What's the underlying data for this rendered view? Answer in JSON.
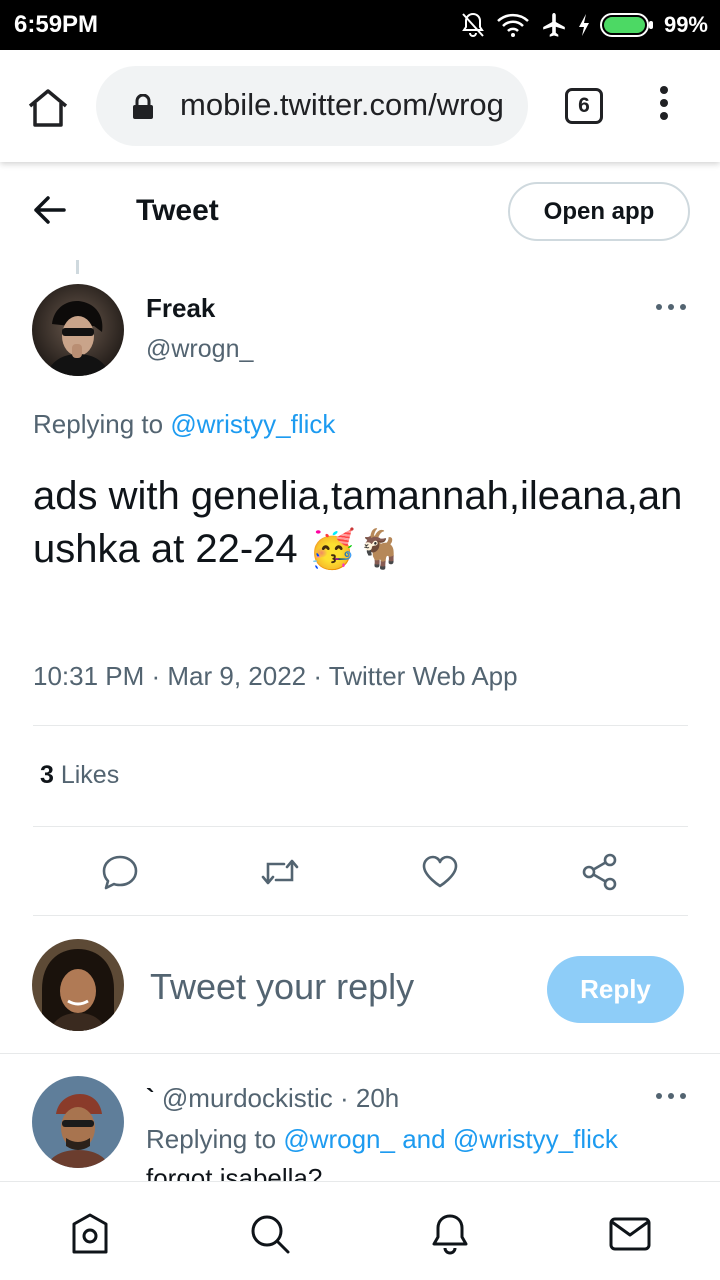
{
  "status_bar": {
    "time": "6:59PM",
    "battery_percent": "99%",
    "icons": [
      "bell-muted-icon",
      "wifi-icon",
      "airplane-icon",
      "charging-bolt-icon",
      "battery-icon"
    ]
  },
  "browser": {
    "url": "mobile.twitter.com/wrogn_",
    "tab_count": "6",
    "icons": [
      "home-icon",
      "lock-icon",
      "overflow-menu-icon"
    ]
  },
  "header": {
    "title": "Tweet",
    "open_app_label": "Open app"
  },
  "tweet": {
    "author_name": "Freak",
    "author_handle": "@wrogn_",
    "replying_prefix": "Replying to ",
    "replying_to": "@wristyy_flick",
    "text": "ads with genelia,tamannah,ileana,anushka at 22-24 ",
    "emojis": "🥳🐐",
    "timestamp": "10:31 PM · Mar 9, 2022 · Twitter Web App",
    "likes_count": "3",
    "likes_label": " Likes"
  },
  "actions": [
    "reply-icon",
    "retweet-icon",
    "like-icon",
    "share-icon"
  ],
  "composer": {
    "placeholder": "Tweet your reply",
    "reply_label": "Reply"
  },
  "reply_tweet": {
    "display_name": "`",
    "handle_time": " @murdockistic · 20h",
    "replying_prefix": "Replying to ",
    "replying_to_1": "@wrogn_",
    "replying_join": " and ",
    "replying_to_2": "@wristyy_flick",
    "text": "forgot isabella?"
  },
  "bottom_nav": [
    "home-icon",
    "search-icon",
    "notifications-icon",
    "messages-icon"
  ],
  "colors": {
    "accent": "#1d9bf0",
    "reply_button_disabled": "#8ecdf8",
    "secondary_text": "#536471"
  }
}
